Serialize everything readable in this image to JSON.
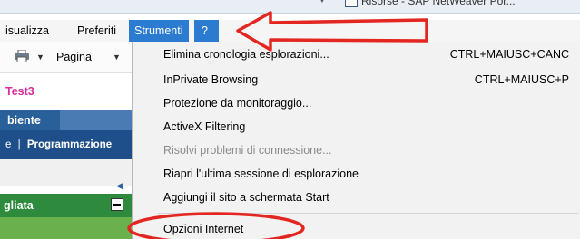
{
  "title_strip": {
    "tab_text": "Risorse - SAP NetWeaver Por..."
  },
  "menu_bar": {
    "items": [
      {
        "label": "isualizza",
        "active": false
      },
      {
        "label": "Preferiti",
        "active": false
      },
      {
        "label": "Strumenti",
        "active": true
      },
      {
        "label": "?",
        "active": true
      }
    ]
  },
  "toolbar": {
    "page_label": "Pagina"
  },
  "portal": {
    "user_name": "Test3",
    "tab_label": "biente",
    "nav_item_1": "e",
    "nav_sep": "|",
    "nav_item_2": "Programmazione",
    "panel_title": "gliata"
  },
  "tools_menu": {
    "items": [
      {
        "label": "Elimina cronologia esplorazioni...",
        "shortcut": "CTRL+MAIUSC+CANC",
        "enabled": true
      },
      {
        "label": "InPrivate Browsing",
        "shortcut": "CTRL+MAIUSC+P",
        "enabled": true
      },
      {
        "label": "Protezione da monitoraggio...",
        "shortcut": "",
        "enabled": true
      },
      {
        "label": "ActiveX Filtering",
        "shortcut": "",
        "enabled": true
      },
      {
        "label": "Risolvi problemi di connessione...",
        "shortcut": "",
        "enabled": false
      },
      {
        "label": "Riapri l'ultima sessione di esplorazione",
        "shortcut": "",
        "enabled": true
      },
      {
        "label": "Aggiungi il sito a schermata Start",
        "shortcut": "",
        "enabled": true
      },
      {
        "label": "Opzioni Internet",
        "shortcut": "",
        "enabled": true
      }
    ]
  },
  "colors": {
    "menu_active": "#2b7bd0",
    "annotation_red": "#e3261f",
    "portal_pink": "#d42c9c",
    "portal_blue": "#1f4f8a",
    "portal_green": "#2e8b3d"
  }
}
